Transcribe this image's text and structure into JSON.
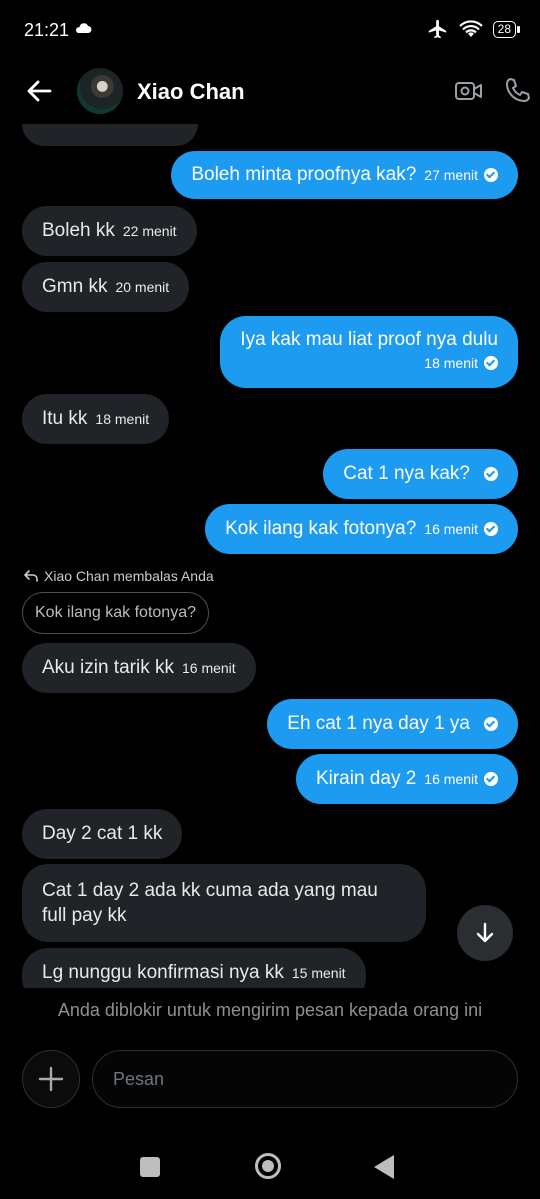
{
  "status_bar": {
    "time": "21:21",
    "battery": "28"
  },
  "header": {
    "contact_name": "Xiao Chan"
  },
  "messages": [
    {
      "text": "Boleh minta proofnya kak?",
      "time": "27 menit"
    },
    {
      "text": "Boleh kk",
      "time": "22 menit"
    },
    {
      "text": "Gmn kk",
      "time": "20 menit"
    },
    {
      "text": "Iya kak mau liat proof nya dulu",
      "time": "18 menit"
    },
    {
      "text": "Itu kk",
      "time": "18 menit"
    },
    {
      "text": "Cat 1 nya kak?"
    },
    {
      "text": "Kok ilang kak fotonya?",
      "time": "16 menit"
    },
    {
      "text": "Aku izin tarik kk",
      "time": "16 menit"
    },
    {
      "text": "Eh cat 1 nya day 1 ya"
    },
    {
      "text": "Kirain day 2",
      "time": "16 menit"
    },
    {
      "text": "Day 2 cat 1 kk"
    },
    {
      "text": "Cat 1 day 2 ada kk cuma ada yang mau full pay kk"
    },
    {
      "text": "Lg nunggu konfirmasi nya kk",
      "time": "15 menit"
    }
  ],
  "reply": {
    "note": "Xiao Chan membalas Anda",
    "quote": "Kok ilang kak fotonya?"
  },
  "blocked_notice": "Anda diblokir untuk mengirim pesan kepada orang ini",
  "composer": {
    "placeholder": "Pesan"
  }
}
